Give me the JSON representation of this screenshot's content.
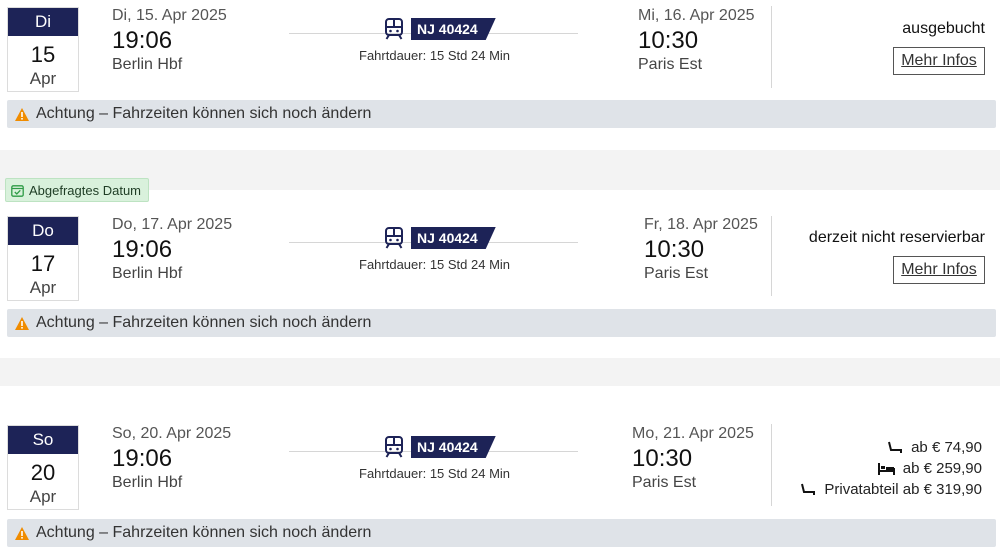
{
  "connections": [
    {
      "date_box": {
        "dow": "Di",
        "day": "15",
        "month": "Apr"
      },
      "departure": {
        "date": "Di, 15. Apr 2025",
        "time": "19:06",
        "station": "Berlin Hbf"
      },
      "train": {
        "number": "NJ 40424",
        "duration": "Fahrtdauer: 15 Std 24 Min"
      },
      "arrival": {
        "date": "Mi, 16. Apr 2025",
        "time": "10:30",
        "station": "Paris Est"
      },
      "status": "ausgebucht",
      "more_button": "Mehr Infos",
      "warning": "Achtung – Fahrzeiten können sich noch ändern"
    },
    {
      "requested_badge": "Abgefragtes Datum",
      "date_box": {
        "dow": "Do",
        "day": "17",
        "month": "Apr"
      },
      "departure": {
        "date": "Do, 17. Apr 2025",
        "time": "19:06",
        "station": "Berlin Hbf"
      },
      "train": {
        "number": "NJ 40424",
        "duration": "Fahrtdauer: 15 Std 24 Min"
      },
      "arrival": {
        "date": "Fr, 18. Apr 2025",
        "time": "10:30",
        "station": "Paris Est"
      },
      "status": "derzeit nicht reservierbar",
      "more_button": "Mehr Infos",
      "warning": "Achtung – Fahrzeiten können sich noch ändern"
    },
    {
      "date_box": {
        "dow": "So",
        "day": "20",
        "month": "Apr"
      },
      "departure": {
        "date": "So, 20. Apr 2025",
        "time": "19:06",
        "station": "Berlin Hbf"
      },
      "train": {
        "number": "NJ 40424",
        "duration": "Fahrtdauer: 15 Std 24 Min"
      },
      "arrival": {
        "date": "Mo, 21. Apr 2025",
        "time": "10:30",
        "station": "Paris Est"
      },
      "prices": [
        {
          "icon": "seat-icon",
          "text": "ab € 74,90"
        },
        {
          "icon": "bed-icon",
          "text": "ab € 259,90"
        },
        {
          "icon": "seat-icon",
          "text": "Privatabteil ab € 319,90"
        }
      ],
      "warning": "Achtung – Fahrzeiten können sich noch ändern"
    }
  ],
  "colors": {
    "brand_navy": "#1d2357",
    "warning_bg": "#dfe3e8",
    "warning_icon": "#f08c00",
    "requested_bg": "#d9f1dc",
    "requested_icon": "#2e9b46"
  }
}
